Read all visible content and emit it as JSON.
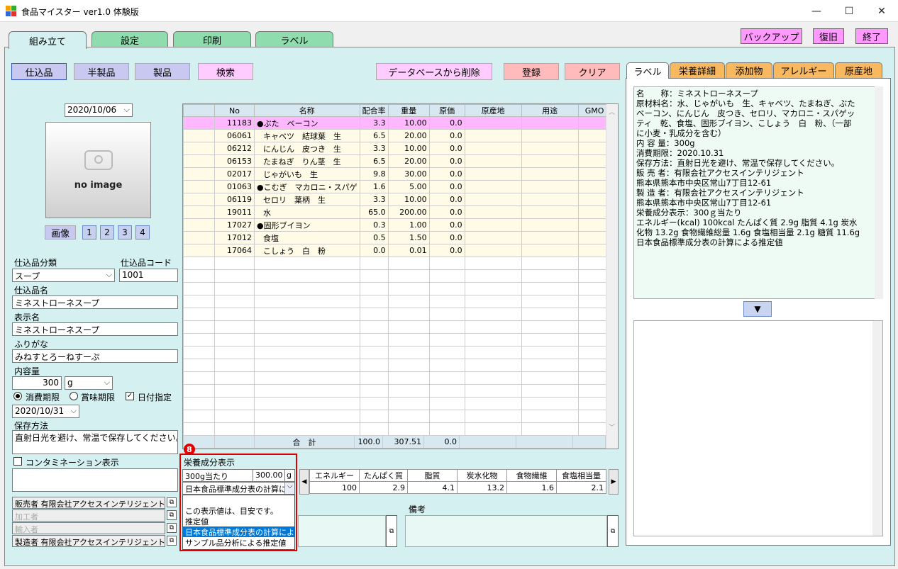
{
  "window": {
    "title": "食品マイスター ver1.0 体験版",
    "minimize": "—",
    "maximize": "☐",
    "close": "✕"
  },
  "main_tabs": [
    "組み立て",
    "設定",
    "印刷",
    "ラベル"
  ],
  "top_buttons": {
    "backup": "バックアップ",
    "restore": "復旧",
    "exit": "終了"
  },
  "mode_buttons": {
    "shikomi": "仕込品",
    "hanseihin": "半製品",
    "seihin": "製品",
    "search": "検索"
  },
  "action_buttons": {
    "delete_db": "データベースから削除",
    "register": "登録",
    "clear": "クリア"
  },
  "left": {
    "date": "2020/10/06",
    "no_image": "no image",
    "image_btn": "画像",
    "image_nums": [
      "1",
      "2",
      "3",
      "4"
    ],
    "category_label": "仕込品分類",
    "category_value": "スープ",
    "code_label": "仕込品コード",
    "code_value": "1001",
    "name_label": "仕込品名",
    "name_value": "ミネストローネスープ",
    "display_label": "表示名",
    "display_value": "ミネストローネスープ",
    "furigana_label": "ふりがな",
    "furigana_value": "みねすとろーねすーぷ",
    "content_label": "内容量",
    "content_value": "300",
    "content_unit": "g",
    "expiry1": "消費期限",
    "expiry2": "賞味期限",
    "date_spec": "日付指定",
    "expiry_date": "2020/10/31",
    "storage_label": "保存方法",
    "storage_value": "直射日光を避け、常温で保存してください。",
    "contamination_label": "コンタミネーション表示",
    "seller": "販売者 有限会社アクセスインテリジェント",
    "processor": "加工者",
    "importer": "輸入者",
    "manufacturer": "製造者 有限会社アクセスインテリジェント"
  },
  "grid": {
    "headers": [
      "No",
      "名称",
      "配合率",
      "重量",
      "原価",
      "原産地",
      "用途",
      "GMO"
    ],
    "rows": [
      {
        "no": "11183",
        "mark": "●",
        "name": "ぶた　ベーコン",
        "rate": "3.3",
        "weight": "10.00",
        "cost": "0.0"
      },
      {
        "no": "06061",
        "mark": "",
        "name": "キャベツ　結球葉　生",
        "rate": "6.5",
        "weight": "20.00",
        "cost": "0.0"
      },
      {
        "no": "06212",
        "mark": "",
        "name": "にんじん　皮つき　生",
        "rate": "3.3",
        "weight": "10.00",
        "cost": "0.0"
      },
      {
        "no": "06153",
        "mark": "",
        "name": "たまねぎ　りん茎　生",
        "rate": "6.5",
        "weight": "20.00",
        "cost": "0.0"
      },
      {
        "no": "02017",
        "mark": "",
        "name": "じゃがいも　生",
        "rate": "9.8",
        "weight": "30.00",
        "cost": "0.0"
      },
      {
        "no": "01063",
        "mark": "●",
        "name": "こむぎ　マカロニ・スパゲ",
        "rate": "1.6",
        "weight": "5.00",
        "cost": "0.0"
      },
      {
        "no": "06119",
        "mark": "",
        "name": "セロリ　葉柄　生",
        "rate": "3.3",
        "weight": "10.00",
        "cost": "0.0"
      },
      {
        "no": "19011",
        "mark": "",
        "name": "水",
        "rate": "65.0",
        "weight": "200.00",
        "cost": "0.0"
      },
      {
        "no": "17027",
        "mark": "●",
        "name": "固形ブイヨン",
        "rate": "0.3",
        "weight": "1.00",
        "cost": "0.0"
      },
      {
        "no": "17012",
        "mark": "",
        "name": "食塩",
        "rate": "0.5",
        "weight": "1.50",
        "cost": "0.0"
      },
      {
        "no": "17064",
        "mark": "",
        "name": "こしょう　白　粉",
        "rate": "0.0",
        "weight": "0.01",
        "cost": "0.0"
      }
    ],
    "total_label": "合　計",
    "total_rate": "100.0",
    "total_weight": "307.51",
    "total_cost": "0.0"
  },
  "nutrition": {
    "badge": "8",
    "title": "栄養成分表示",
    "per_label": "300g当たり",
    "per_value": "300.00",
    "per_unit": "g",
    "selected": "日本食品標準成分表の計算による推定値",
    "options": [
      "この表示値は、目安です。",
      "推定値",
      "日本食品標準成分表の計算による推定値",
      "サンプル品分析による推定値"
    ],
    "headers": [
      "エネルギー",
      "たんぱく質",
      "脂質",
      "炭水化物",
      "食物繊維",
      "食塩相当量"
    ],
    "values": [
      "100",
      "2.9",
      "4.1",
      "13.2",
      "1.6",
      "2.1"
    ]
  },
  "remarks_label": "備考",
  "right_tabs": [
    "ラベル",
    "栄養詳細",
    "添加物",
    "アレルギー",
    "原産地"
  ],
  "label_lines": [
    "名　　称：ミネストローネスープ",
    "原材料名：水、じゃがいも　生、キャベツ、たまねぎ、ぶた",
    "ベーコン、にんじん　皮つき、セロリ、マカロニ・スパゲッ",
    "ティ　乾、食塩、固形ブイヨン、こしょう　白　粉、（一部",
    "に小麦・乳成分を含む）",
    "内 容 量：300g",
    "消費期限：2020.10.31",
    "保存方法：直射日光を避け、常温で保存してください。",
    "販 売 者：有限会社アクセスインテリジェント",
    "熊本県熊本市中央区常山7丁目12-61",
    "製 造 者：有限会社アクセスインテリジェント",
    "熊本県熊本市中央区常山7丁目12-61",
    "栄養成分表示：300ｇ当たり",
    "エネルギー(kcal) 100kcal たんぱく質 2.9g 脂質 4.1g 炭水",
    "化物 13.2g 食物繊維総量 1.6g 食塩相当量 2.1g 糖質 11.6g",
    "日本食品標準成分表の計算による推定値"
  ],
  "colors": {
    "frame": "#d4f0f0",
    "tab_green": "#8fdcae",
    "highlight_row": "#ffb8ff",
    "row_bg": "#fffbe6",
    "red_border": "#e00000"
  }
}
